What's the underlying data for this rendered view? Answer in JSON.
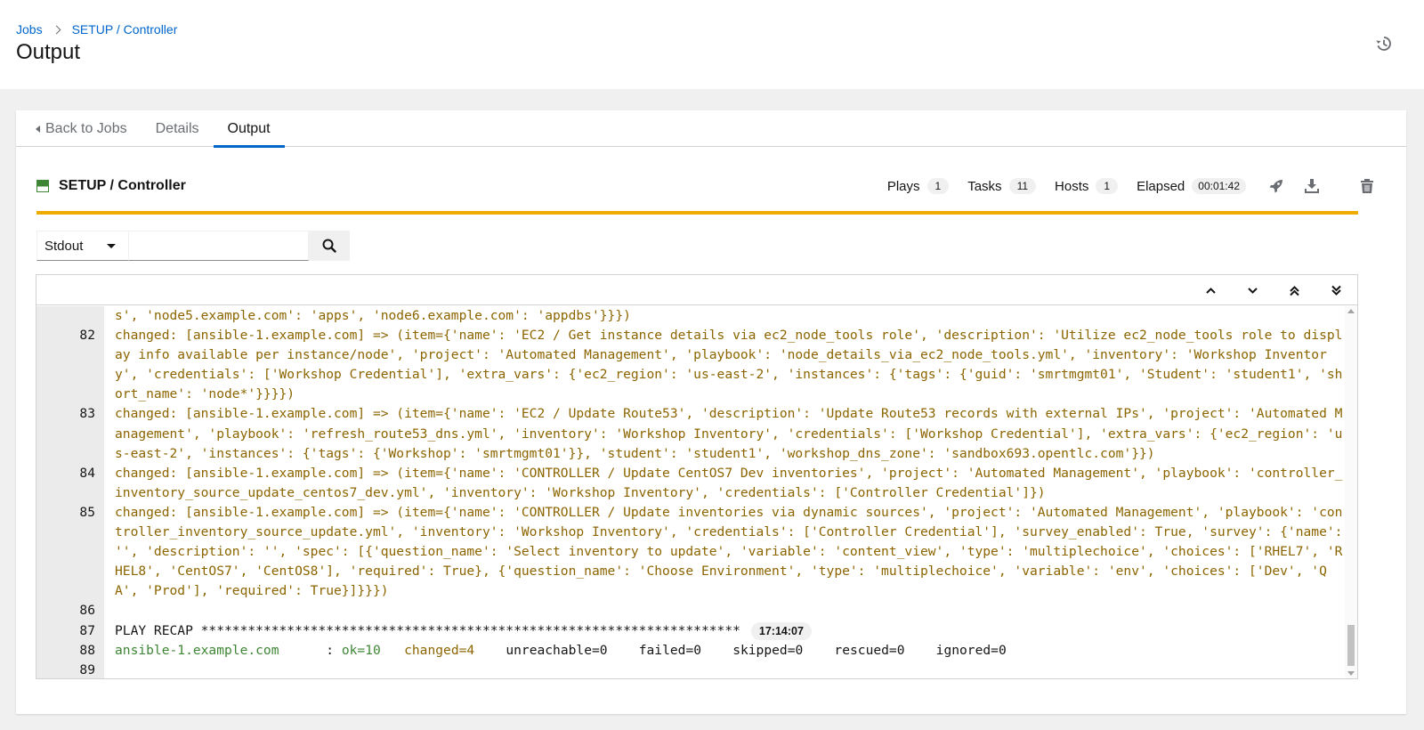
{
  "breadcrumb": {
    "jobs": "Jobs",
    "current": "SETUP / Controller"
  },
  "page": {
    "title": "Output"
  },
  "tabs": {
    "back": "Back to Jobs",
    "details": "Details",
    "output": "Output"
  },
  "job": {
    "name": "SETUP / Controller",
    "plays_label": "Plays",
    "plays": "1",
    "tasks_label": "Tasks",
    "tasks": "11",
    "hosts_label": "Hosts",
    "hosts": "1",
    "elapsed_label": "Elapsed",
    "elapsed": "00:01:42"
  },
  "search": {
    "select_value": "Stdout",
    "placeholder": ""
  },
  "icons": {
    "history": "history-icon",
    "launch": "rocket-icon",
    "download": "download-icon",
    "delete": "trash-icon",
    "search": "search-icon",
    "up": "angle-up-icon",
    "down": "angle-down-icon",
    "top": "angle-double-up-icon",
    "bottom": "angle-double-down-icon"
  },
  "colors": {
    "changed": "#8c6500",
    "ok": "#3e8635",
    "progress": "#f0ab00",
    "link": "#0066cc"
  },
  "log": {
    "l81_cont": "s', 'node5.example.com': 'apps', 'node6.example.com': 'appdbs'}}})",
    "l82": {
      "n": "82",
      "text": "changed: [ansible-1.example.com] => (item={'name': 'EC2 / Get instance details via ec2_node_tools role', 'description': 'Utilize ec2_node_tools role to display info available per instance/node', 'project': 'Automated Management', 'playbook': 'node_details_via_ec2_node_tools.yml', 'inventory': 'Workshop Inventory', 'credentials': ['Workshop Credential'], 'extra_vars': {'ec2_region': 'us-east-2', 'instances': {'tags': {'guid': 'smrtmgmt01', 'Student': 'student1', 'short_name': 'node*'}}}})"
    },
    "l83": {
      "n": "83",
      "text": "changed: [ansible-1.example.com] => (item={'name': 'EC2 / Update Route53', 'description': 'Update Route53 records with external IPs', 'project': 'Automated Management', 'playbook': 'refresh_route53_dns.yml', 'inventory': 'Workshop Inventory', 'credentials': ['Workshop Credential'], 'extra_vars': {'ec2_region': 'us-east-2', 'instances': {'tags': {'Workshop': 'smrtmgmt01'}}, 'student': 'student1', 'workshop_dns_zone': 'sandbox693.opentlc.com'}})"
    },
    "l84": {
      "n": "84",
      "text": "changed: [ansible-1.example.com] => (item={'name': 'CONTROLLER / Update CentOS7 Dev inventories', 'project': 'Automated Management', 'playbook': 'controller_inventory_source_update_centos7_dev.yml', 'inventory': 'Workshop Inventory', 'credentials': ['Controller Credential']})"
    },
    "l85": {
      "n": "85",
      "text": "changed: [ansible-1.example.com] => (item={'name': 'CONTROLLER / Update inventories via dynamic sources', 'project': 'Automated Management', 'playbook': 'controller_inventory_source_update.yml', 'inventory': 'Workshop Inventory', 'credentials': ['Controller Credential'], 'survey_enabled': True, 'survey': {'name': '', 'description': '', 'spec': [{'question_name': 'Select inventory to update', 'variable': 'content_view', 'type': 'multiplechoice', 'choices': ['RHEL7', 'RHEL8', 'CentOS7', 'CentOS8'], 'required': True}, {'question_name': 'Choose Environment', 'type': 'multiplechoice', 'variable': 'env', 'choices': ['Dev', 'QA', 'Prod'], 'required': True}]}}})"
    },
    "l86": {
      "n": "86"
    },
    "l87": {
      "n": "87",
      "text": "PLAY RECAP *********************************************************************",
      "time": "17:14:07"
    },
    "l88": {
      "n": "88",
      "host": "ansible-1.example.com",
      "sep": "      : ",
      "ok": "ok=10",
      "changed": "changed=4",
      "unreachable": "unreachable=0",
      "failed": "failed=0",
      "skipped": "skipped=0",
      "rescued": "rescued=0",
      "ignored": "ignored=0"
    },
    "l89": {
      "n": "89"
    }
  }
}
